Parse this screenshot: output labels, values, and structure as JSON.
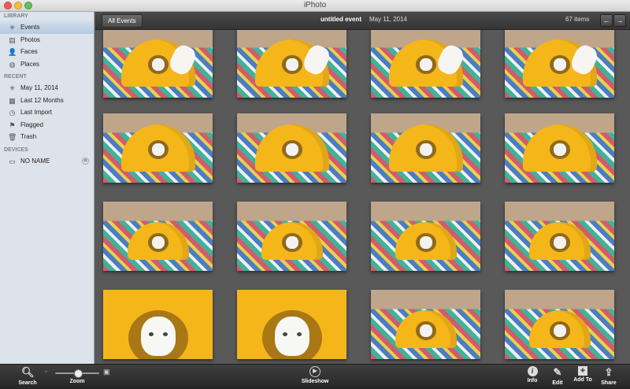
{
  "window": {
    "title": "iPhoto"
  },
  "sidebar": {
    "library": {
      "heading": "LIBRARY",
      "items": [
        {
          "label": "Events",
          "icon": "events-icon",
          "selected": true
        },
        {
          "label": "Photos",
          "icon": "photos-icon"
        },
        {
          "label": "Faces",
          "icon": "faces-icon"
        },
        {
          "label": "Places",
          "icon": "places-icon"
        }
      ]
    },
    "recent": {
      "heading": "RECENT",
      "items": [
        {
          "label": "May 11, 2014",
          "icon": "event-icon"
        },
        {
          "label": "Last 12 Months",
          "icon": "calendar-icon"
        },
        {
          "label": "Last Import",
          "icon": "clock-icon"
        },
        {
          "label": "Flagged",
          "icon": "flag-icon"
        },
        {
          "label": "Trash",
          "icon": "trash-icon"
        }
      ]
    },
    "devices": {
      "heading": "DEVICES",
      "items": [
        {
          "label": "NO NAME",
          "icon": "drive-icon",
          "eject": "⏏"
        }
      ]
    }
  },
  "toolbar": {
    "all_events": "All Events",
    "event_title": "untitled event",
    "event_date": "May 11, 2014",
    "item_count": "67 items",
    "prev": "←",
    "next": "→"
  },
  "photos": [
    {
      "variant": "inside"
    },
    {
      "variant": "inside"
    },
    {
      "variant": "inside"
    },
    {
      "variant": "inside"
    },
    {
      "variant": "peek"
    },
    {
      "variant": "peek"
    },
    {
      "variant": "peek"
    },
    {
      "variant": "peek"
    },
    {
      "variant": "far"
    },
    {
      "variant": "far"
    },
    {
      "variant": "far"
    },
    {
      "variant": "far"
    },
    {
      "variant": "close"
    },
    {
      "variant": "close"
    },
    {
      "variant": "far"
    },
    {
      "variant": "far"
    }
  ],
  "bottom": {
    "search": "Search",
    "zoom": "Zoom",
    "slideshow": "Slideshow",
    "info": "Info",
    "edit": "Edit",
    "add_to": "Add To",
    "share": "Share"
  },
  "colors": {
    "accent_selected": "#c3d4e8",
    "tent_yellow": "#f5b61a"
  }
}
